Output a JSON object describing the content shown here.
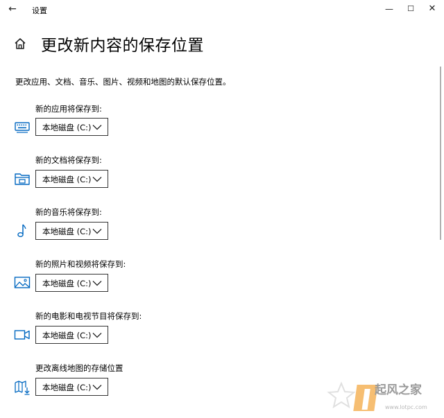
{
  "window": {
    "title": "设置",
    "back_glyph": "←",
    "min_glyph": "—",
    "max_glyph": "☐",
    "close_glyph": "✕"
  },
  "page": {
    "title": "更改新内容的保存位置",
    "description": "更改应用、文档、音乐、图片、视频和地图的默认保存位置。"
  },
  "groups": [
    {
      "label": "新的应用将保存到:",
      "icon": "keyboard-icon",
      "value": "本地磁盘 (C:)"
    },
    {
      "label": "新的文档将保存到:",
      "icon": "documents-folder-icon",
      "value": "本地磁盘 (C:)"
    },
    {
      "label": "新的音乐将保存到:",
      "icon": "music-note-icon",
      "value": "本地磁盘 (C:)"
    },
    {
      "label": "新的照片和视频将保存到:",
      "icon": "picture-icon",
      "value": "本地磁盘 (C:)"
    },
    {
      "label": "新的电影和电视节目将保存到:",
      "icon": "video-camera-icon",
      "value": "本地磁盘 (C:)"
    },
    {
      "label": "更改离线地图的存储位置",
      "icon": "map-download-icon",
      "value": "本地磁盘 (C:)"
    }
  ],
  "watermark": {
    "text": "起风之家",
    "url": "www.lotpc.com"
  },
  "colors": {
    "accent": "#0067c0",
    "border": "#333333"
  }
}
